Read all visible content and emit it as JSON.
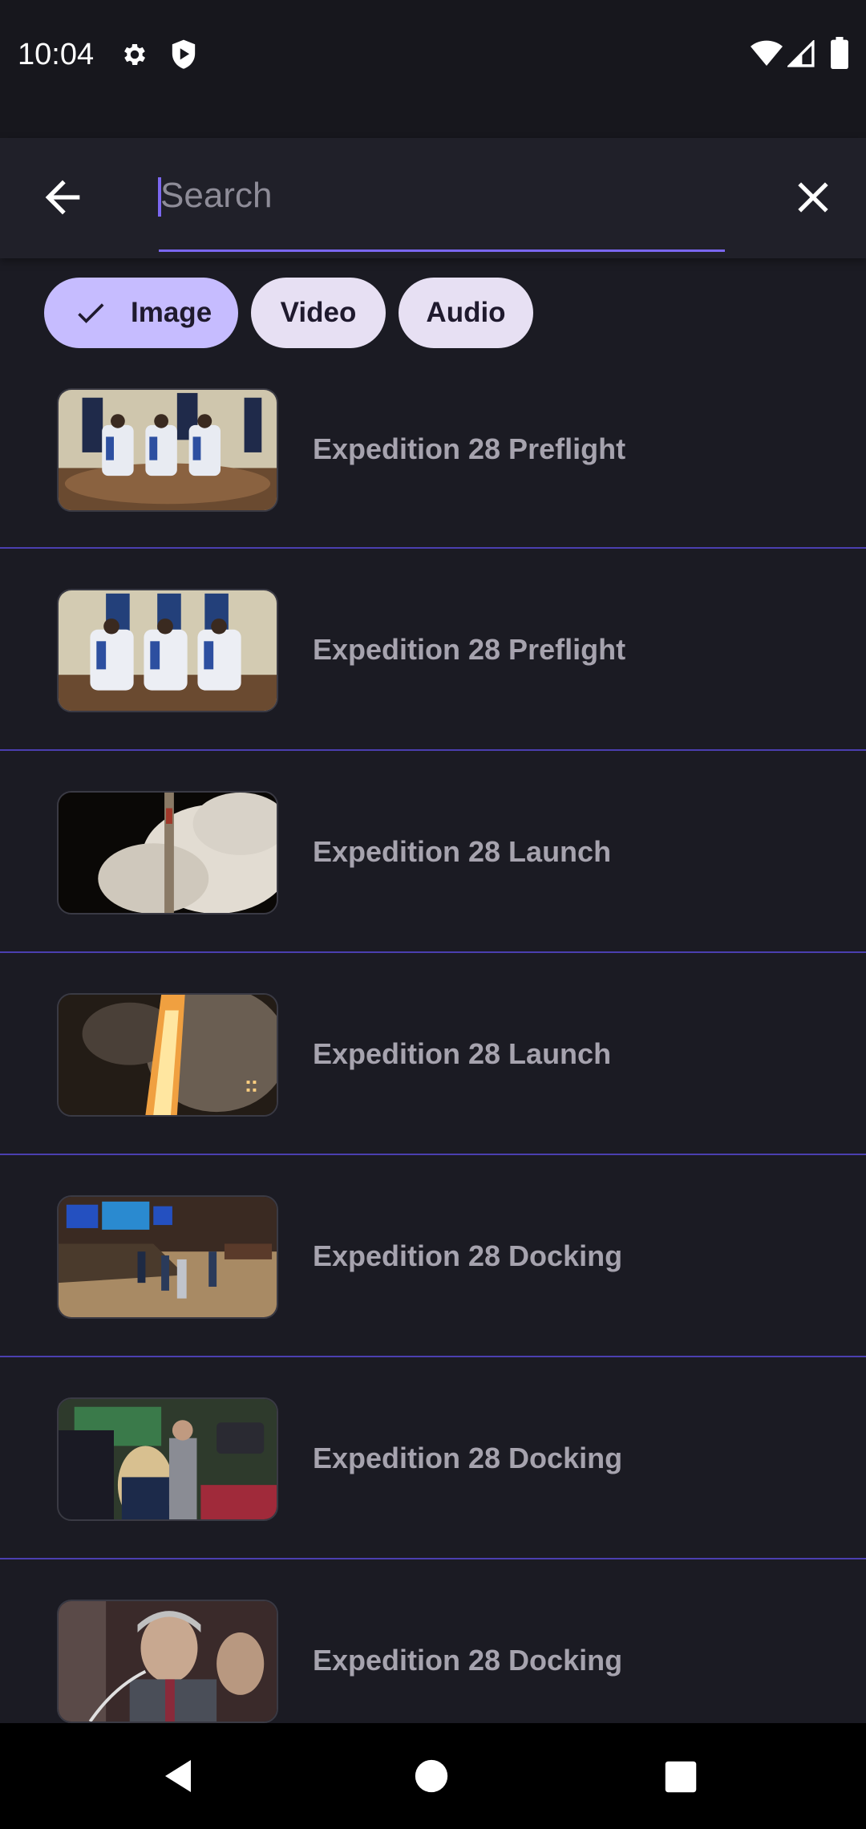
{
  "status_bar": {
    "time": "10:04",
    "icons": [
      "settings-icon",
      "play-shield-icon",
      "wifi-icon",
      "signal-icon",
      "battery-icon"
    ]
  },
  "search": {
    "placeholder": "Search",
    "value": "",
    "back_icon": "arrow-back-icon",
    "clear_icon": "close-icon",
    "accent_color": "#7b67f0"
  },
  "filters": {
    "chips": [
      {
        "label": "Image",
        "selected": true
      },
      {
        "label": "Video",
        "selected": false
      },
      {
        "label": "Audio",
        "selected": false
      }
    ],
    "selected_color": "#c6bcff",
    "unselected_color": "#e7e0f3"
  },
  "results": [
    {
      "title": "Expedition 28 Preflight",
      "thumbnail": "crew-seated-in-spacesuits"
    },
    {
      "title": "Expedition 28 Preflight",
      "thumbnail": "crew-seated-in-spacesuits"
    },
    {
      "title": "Expedition 28 Launch",
      "thumbnail": "rocket-launch-smoke"
    },
    {
      "title": "Expedition 28 Launch",
      "thumbnail": "rocket-launch-fire-night"
    },
    {
      "title": "Expedition 28 Docking",
      "thumbnail": "mission-control-room"
    },
    {
      "title": "Expedition 28 Docking",
      "thumbnail": "people-in-control-room-with-camera"
    },
    {
      "title": "Expedition 28 Docking",
      "thumbnail": "man-on-telephone"
    }
  ],
  "nav_bar": {
    "buttons": [
      "back-triangle-icon",
      "home-circle-icon",
      "recents-square-icon"
    ]
  }
}
